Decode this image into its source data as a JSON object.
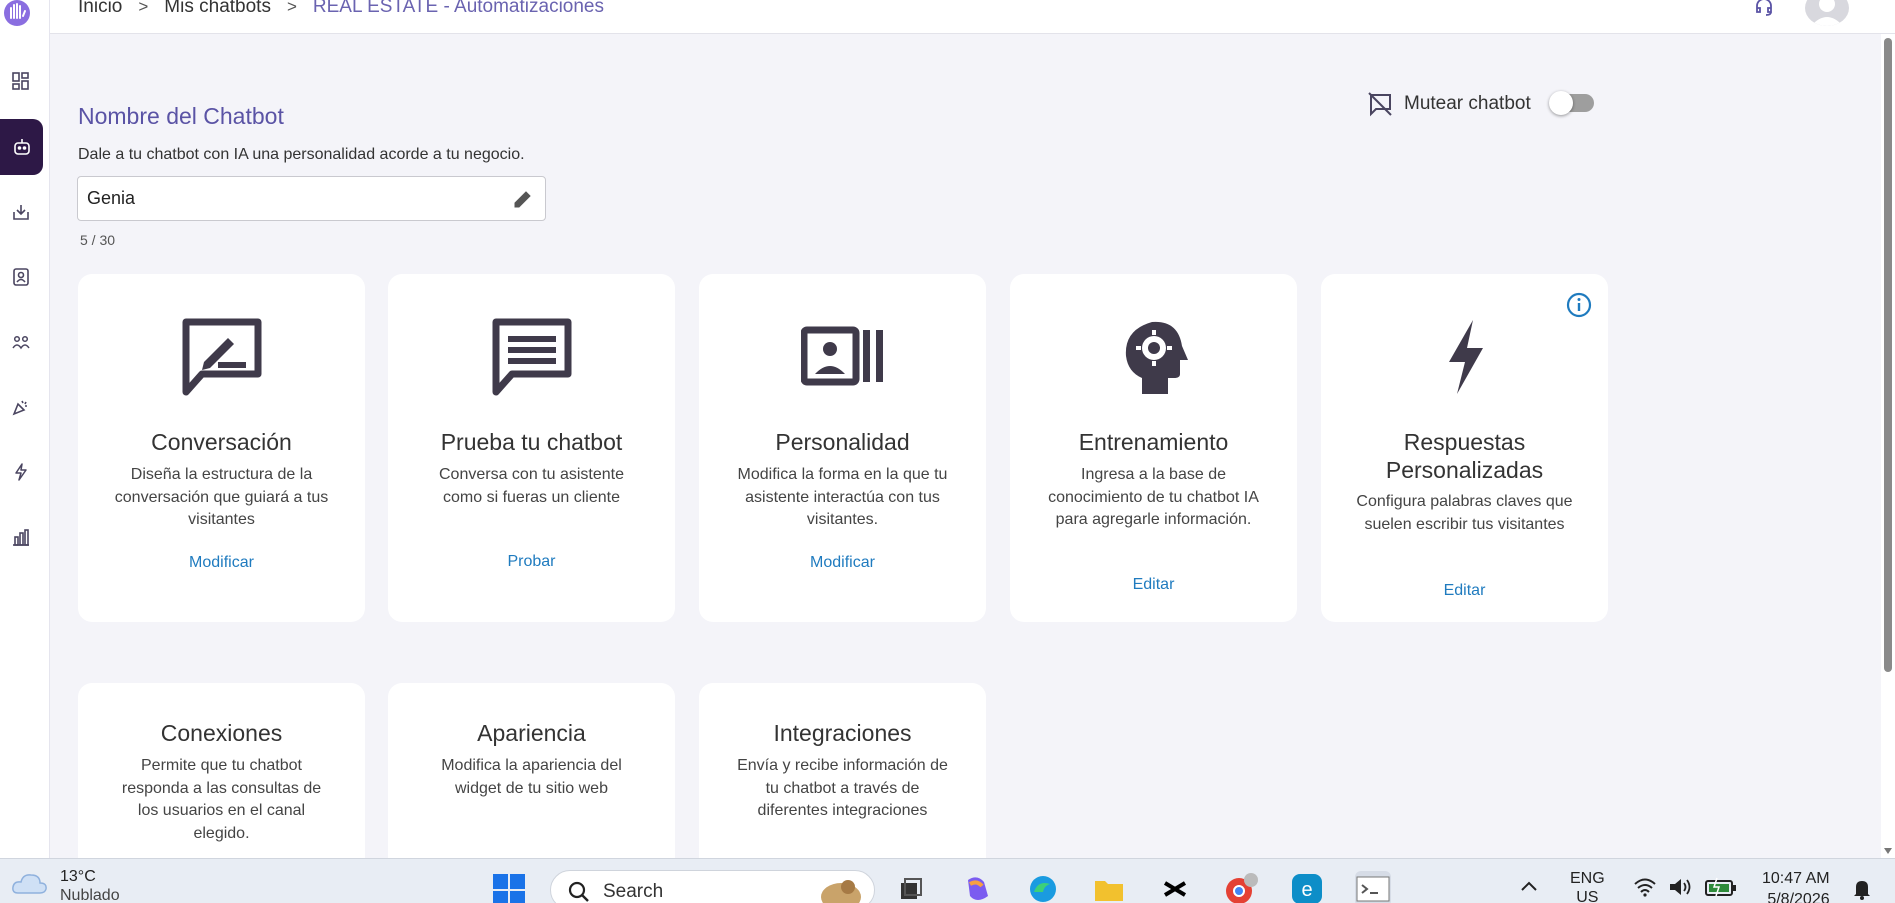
{
  "header": {
    "breadcrumbs": [
      "Inicio",
      "Mis chatbots",
      "REAL ESTATE - Automatizaciones"
    ]
  },
  "main": {
    "title": "Nombre del Chatbot",
    "subtitle": "Dale a tu chatbot con IA una personalidad acorde a tu negocio.",
    "name_value": "Genia",
    "counter": "5 / 30",
    "mute_label": "Mutear chatbot",
    "mute_on": false
  },
  "cards": [
    {
      "title": "Conversación",
      "desc": "Diseña la estructura de la conversación que guiará a tus visitantes",
      "link": "Modificar",
      "icon": "chat-edit-icon"
    },
    {
      "title": "Prueba tu chatbot",
      "desc": "Conversa con tu asistente como si fueras un cliente",
      "link": "Probar",
      "icon": "chat-lines-icon"
    },
    {
      "title": "Personalidad",
      "desc": "Modifica la forma en la que tu asistente interactúa con tus visitantes.",
      "link": "Modificar",
      "icon": "profile-card-icon"
    },
    {
      "title": "Entrenamiento",
      "desc": "Ingresa a la base de conocimiento de tu chatbot IA para agregarle información.",
      "link": "Editar",
      "icon": "head-gear-icon"
    },
    {
      "title": "Respuestas Personalizadas",
      "desc": "Configura palabras claves que suelen escribir tus visitantes",
      "link": "Editar",
      "icon": "bolt-icon"
    },
    {
      "title": "Conexiones",
      "desc": "Permite que tu chatbot responda a las consultas de los usuarios en el canal elegido.",
      "link": "",
      "icon": ""
    },
    {
      "title": "Apariencia",
      "desc": "Modifica la apariencia del widget de tu sitio web",
      "link": "",
      "icon": ""
    },
    {
      "title": "Integraciones",
      "desc": "Envía y recibe información de tu chatbot a través de diferentes integraciones",
      "link": "",
      "icon": ""
    }
  ],
  "taskbar": {
    "temperature": "13°C",
    "weather": "Nublado",
    "search_placeholder": "Search",
    "lang1": "ENG",
    "lang2": "US",
    "time": "10:47 AM",
    "date": "5/8/2026"
  },
  "colors": {
    "accent": "#5a53a5",
    "sidebar_active": "#2d1846",
    "link": "#1f7bbf",
    "icon_dark": "#3f3a4a"
  }
}
